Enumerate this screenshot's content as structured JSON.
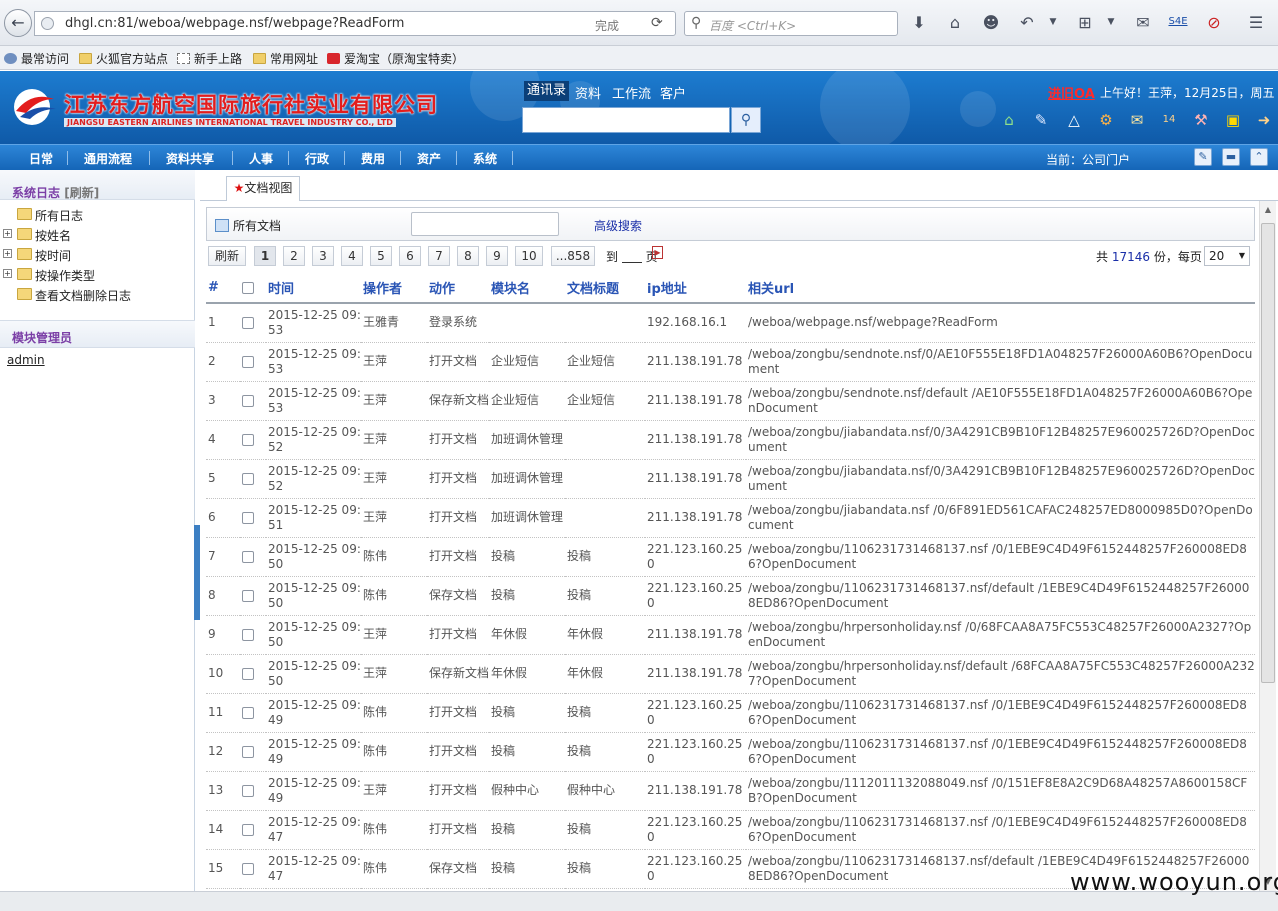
{
  "browser": {
    "url": "dhgl.cn:81/weboa/webpage.nsf/webpage?ReadForm",
    "status": "完成",
    "search_placeholder": "百度 <Ctrl+K>",
    "bookmarks": [
      {
        "label": "最常访问",
        "icon": "gear-icon"
      },
      {
        "label": "火狐官方站点",
        "icon": "folder-icon"
      },
      {
        "label": "新手上路",
        "icon": "page-icon"
      },
      {
        "label": "常用网址",
        "icon": "folder-icon"
      },
      {
        "label": "爱淘宝（原淘宝特卖）",
        "icon": "taobao-icon"
      }
    ]
  },
  "header": {
    "company_cn": "江苏东方航空国际旅行社实业有限公司",
    "company_en": "JIANGSU EASTERN AIRLINES INTERNATIONAL TRAVEL INDUSTRY CO., LTD",
    "tabs": [
      "通讯录",
      "资料",
      "工作流",
      "客户"
    ],
    "jinjiu": "进旧OA",
    "greeting": "上午好！王萍，12月25日，周五"
  },
  "menu": {
    "items": [
      "日常",
      "通用流程",
      "资料共享",
      "人事",
      "行政",
      "费用",
      "资产",
      "系统"
    ],
    "current": "当前：公司门户"
  },
  "sidebar": {
    "title": "系统日志",
    "refresh": "[刷新]",
    "tree": [
      {
        "label": "所有日志",
        "expandable": false
      },
      {
        "label": "按姓名",
        "expandable": true
      },
      {
        "label": "按时间",
        "expandable": true
      },
      {
        "label": "按操作类型",
        "expandable": true
      },
      {
        "label": "查看文档删除日志",
        "expandable": false
      }
    ],
    "admin_title": "模块管理员",
    "admin": "admin"
  },
  "main": {
    "tab": "文档视图",
    "all_docs": "所有文档",
    "adv_search": "高级搜索",
    "pager": {
      "refresh": "刷新",
      "pages": [
        "1",
        "2",
        "3",
        "4",
        "5",
        "6",
        "7",
        "8",
        "9",
        "10",
        "...858"
      ],
      "goto_prefix": "到",
      "goto_suffix": "页",
      "total_prefix": "共",
      "total": "17146",
      "total_suffix": "份，每页",
      "per_page": "20"
    },
    "columns": [
      "#",
      "",
      "时间",
      "操作者",
      "动作",
      "模块名",
      "文档标题",
      "ip地址",
      "相关url"
    ],
    "rows": [
      {
        "n": "1",
        "time": "2015-12-25 09:53",
        "user": "王雅青",
        "action": "登录系统",
        "module": "",
        "title": "",
        "ip": "192.168.16.1",
        "url": "/weboa/webpage.nsf/webpage?ReadForm"
      },
      {
        "n": "2",
        "time": "2015-12-25 09:53",
        "user": "王萍",
        "action": "打开文档",
        "module": "企业短信",
        "title": "企业短信",
        "ip": "211.138.191.78",
        "url": "/weboa/zongbu/sendnote.nsf/0/AE10F555E18FD1A048257F26000A60B6?OpenDocument"
      },
      {
        "n": "3",
        "time": "2015-12-25 09:53",
        "user": "王萍",
        "action": "保存新文档",
        "module": "企业短信",
        "title": "企业短信",
        "ip": "211.138.191.78",
        "url": "/weboa/zongbu/sendnote.nsf/default /AE10F555E18FD1A048257F26000A60B6?OpenDocument"
      },
      {
        "n": "4",
        "time": "2015-12-25 09:52",
        "user": "王萍",
        "action": "打开文档",
        "module": "加班调休管理",
        "title": "",
        "ip": "211.138.191.78",
        "url": "/weboa/zongbu/jiabandata.nsf/0/3A4291CB9B10F12B48257E960025726D?OpenDocument"
      },
      {
        "n": "5",
        "time": "2015-12-25 09:52",
        "user": "王萍",
        "action": "打开文档",
        "module": "加班调休管理",
        "title": "",
        "ip": "211.138.191.78",
        "url": "/weboa/zongbu/jiabandata.nsf/0/3A4291CB9B10F12B48257E960025726D?OpenDocument"
      },
      {
        "n": "6",
        "time": "2015-12-25 09:51",
        "user": "王萍",
        "action": "打开文档",
        "module": "加班调休管理",
        "title": "",
        "ip": "211.138.191.78",
        "url": "/weboa/zongbu/jiabandata.nsf /0/6F891ED561CAFAC248257ED8000985D0?OpenDocument"
      },
      {
        "n": "7",
        "time": "2015-12-25 09:50",
        "user": "陈伟",
        "action": "打开文档",
        "module": "投稿",
        "title": "投稿",
        "ip": "221.123.160.250",
        "url": "/weboa/zongbu/1106231731468137.nsf /0/1EBE9C4D49F6152448257F260008ED86?OpenDocument"
      },
      {
        "n": "8",
        "time": "2015-12-25 09:50",
        "user": "陈伟",
        "action": "保存文档",
        "module": "投稿",
        "title": "投稿",
        "ip": "221.123.160.250",
        "url": "/weboa/zongbu/1106231731468137.nsf/default /1EBE9C4D49F6152448257F260008ED86?OpenDocument"
      },
      {
        "n": "9",
        "time": "2015-12-25 09:50",
        "user": "王萍",
        "action": "打开文档",
        "module": "年休假",
        "title": "年休假",
        "ip": "211.138.191.78",
        "url": "/weboa/zongbu/hrpersonholiday.nsf /0/68FCAA8A75FC553C48257F26000A2327?OpenDocument"
      },
      {
        "n": "10",
        "time": "2015-12-25 09:50",
        "user": "王萍",
        "action": "保存新文档",
        "module": "年休假",
        "title": "年休假",
        "ip": "211.138.191.78",
        "url": "/weboa/zongbu/hrpersonholiday.nsf/default /68FCAA8A75FC553C48257F26000A2327?OpenDocument"
      },
      {
        "n": "11",
        "time": "2015-12-25 09:49",
        "user": "陈伟",
        "action": "打开文档",
        "module": "投稿",
        "title": "投稿",
        "ip": "221.123.160.250",
        "url": "/weboa/zongbu/1106231731468137.nsf /0/1EBE9C4D49F6152448257F260008ED86?OpenDocument"
      },
      {
        "n": "12",
        "time": "2015-12-25 09:49",
        "user": "陈伟",
        "action": "打开文档",
        "module": "投稿",
        "title": "投稿",
        "ip": "221.123.160.250",
        "url": "/weboa/zongbu/1106231731468137.nsf /0/1EBE9C4D49F6152448257F260008ED86?OpenDocument"
      },
      {
        "n": "13",
        "time": "2015-12-25 09:49",
        "user": "王萍",
        "action": "打开文档",
        "module": "假种中心",
        "title": "假种中心",
        "ip": "211.138.191.78",
        "url": "/weboa/zongbu/1112011132088049.nsf /0/151EF8E8A2C9D68A48257A8600158CFB?OpenDocument"
      },
      {
        "n": "14",
        "time": "2015-12-25 09:47",
        "user": "陈伟",
        "action": "打开文档",
        "module": "投稿",
        "title": "投稿",
        "ip": "221.123.160.250",
        "url": "/weboa/zongbu/1106231731468137.nsf /0/1EBE9C4D49F6152448257F260008ED86?OpenDocument"
      },
      {
        "n": "15",
        "time": "2015-12-25 09:47",
        "user": "陈伟",
        "action": "保存文档",
        "module": "投稿",
        "title": "投稿",
        "ip": "221.123.160.250",
        "url": "/weboa/zongbu/1106231731468137.nsf/default /1EBE9C4D49F6152448257F260008ED86?OpenDocument"
      }
    ]
  },
  "watermark": "www.wooyun.org",
  "colors": {
    "header_blue": "#1565b7",
    "link_blue": "#2a55b5",
    "brand_red": "#e31d1d",
    "sidebar_title": "#7b3fa6"
  }
}
